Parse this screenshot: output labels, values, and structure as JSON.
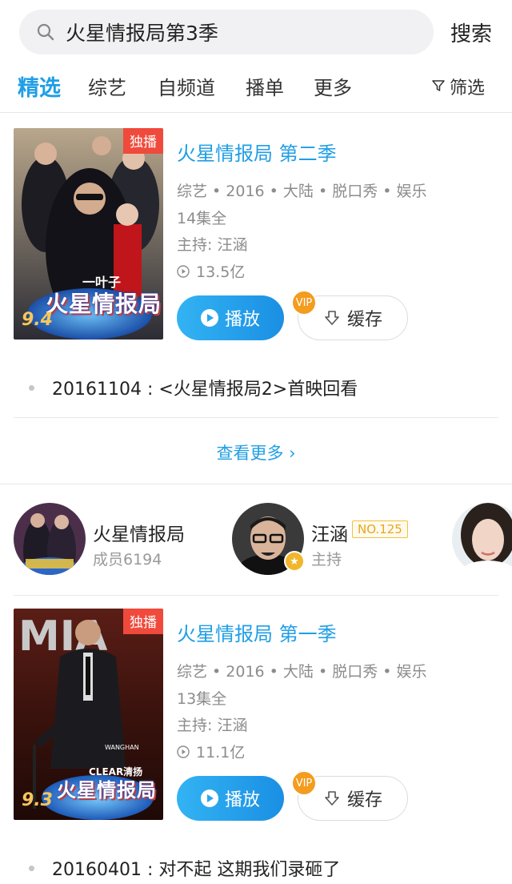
{
  "search": {
    "query": "火星情报局第3季",
    "button_label": "搜索"
  },
  "tabs": [
    {
      "label": "精选",
      "active": true
    },
    {
      "label": "综艺",
      "active": false
    },
    {
      "label": "自频道",
      "active": false
    },
    {
      "label": "播单",
      "active": false
    },
    {
      "label": "更多",
      "active": false
    }
  ],
  "filter_label": "筛选",
  "shows": [
    {
      "title": "火星情报局 第二季",
      "badge": "独播",
      "score": "9.4",
      "meta": "综艺 • 2016 • 大陆 • 脱口秀 • 娱乐",
      "episodes": "14集全",
      "host": "主持: 汪涵",
      "views": "13.5亿",
      "play_label": "播放",
      "cache_label": "缓存",
      "vip": "VIP",
      "poster_text": "火星情报局",
      "poster_subtext": "一叶子",
      "latest": "20161104 : <火星情报局2>首映回看"
    },
    {
      "title": "火星情报局 第一季",
      "badge": "独播",
      "score": "9.3",
      "meta": "综艺 • 2016 • 大陆 • 脱口秀 • 娱乐",
      "episodes": "13集全",
      "host": "主持: 汪涵",
      "views": "11.1亿",
      "play_label": "播放",
      "cache_label": "缓存",
      "vip": "VIP",
      "poster_text": "火星情报局",
      "poster_subtext": "CLEAR清扬",
      "poster_bigtext": "MIA",
      "poster_name": "WANGHAN",
      "latest": "20160401 : 对不起 这期我们录砸了"
    }
  ],
  "more_label": "查看更多 ›",
  "people": [
    {
      "name": "火星情报局",
      "sub": "成员6194"
    },
    {
      "name": "汪涵",
      "sub": "主持",
      "rank": "NO.125"
    }
  ],
  "colors": {
    "accent": "#1f9ee5",
    "exclusive_badge": "#f04a3c",
    "vip": "#f39c1f"
  }
}
